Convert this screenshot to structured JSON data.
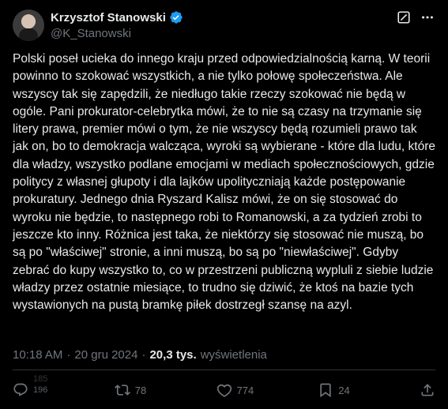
{
  "author": {
    "name": "Krzysztof Stanowski",
    "handle": "@K_Stanowski",
    "verified_icon": "verified-badge-icon"
  },
  "post": {
    "text": "Polski poseł ucieka do innego kraju przed odpowiedzialnością karną. W teorii powinno to szokować wszystkich, a nie tylko połowę społeczeństwa. Ale wszyscy tak się zapędzili, że niedługo takie rzeczy szokować nie będą w ogóle. Pani prokurator-celebrytka mówi, że to nie są czasy na trzymanie się litery prawa, premier mówi o tym, że nie wszyscy będą rozumieli prawo tak jak on, bo to demokracja walcząca, wyroki są wybierane - które dla ludu, które dla władzy, wszystko podlane emocjami w mediach społecznościowych, gdzie politycy z własnej głupoty i dla lajków upolityczniają każde postępowanie prokuratury. Jednego dnia Ryszard Kalisz mówi, że on się stosować do wyroku nie będzie, to następnego robi to Romanowski, a za tydzień zrobi to jeszcze kto inny. Różnica jest taka, że niektórzy się stosować nie muszą, bo są po \"właściwej\" stronie, a inni muszą, bo są po \"niewłaściwej\". Gdyby zebrać do kupy wszystko to, co w przestrzeni publiczną wypluli z siebie ludzie władzy przez ostatnie miesiące, to trudno się dziwić, że ktoś na bazie tych wystawionych na pustą bramkę piłek dostrzegł szansę na azyl."
  },
  "meta": {
    "time": "10:18 AM",
    "sep1": "·",
    "date": "20 gru 2024",
    "sep2": "·",
    "views_count": "20,3 tys.",
    "views_label": "wyświetlenia"
  },
  "actions": {
    "replies_top": "185",
    "replies": "196",
    "reposts": "78",
    "likes": "774",
    "bookmarks": "24"
  },
  "colors": {
    "background": "#000000",
    "text": "#e7e9ea",
    "muted": "#71767b",
    "verified": "#1d9bf0"
  }
}
